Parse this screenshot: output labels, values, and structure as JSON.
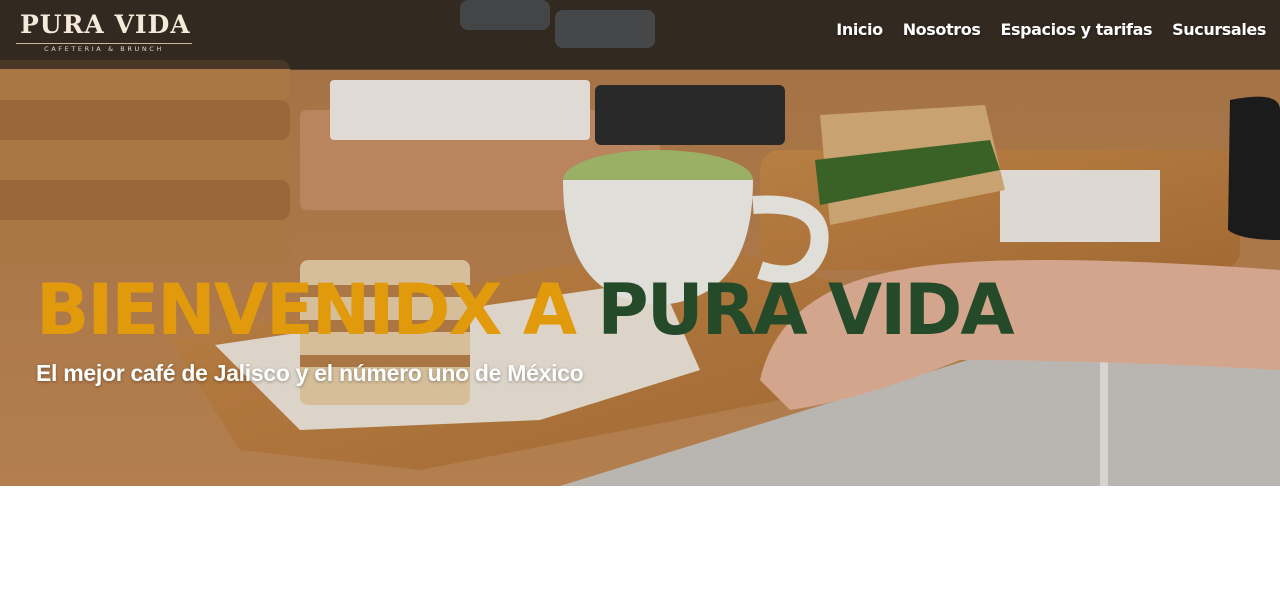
{
  "header": {
    "logo": {
      "name": "PURA VIDA",
      "tagline": "CAFETERIA & BRUNCH"
    },
    "nav": [
      {
        "label": "Inicio"
      },
      {
        "label": "Nosotros"
      },
      {
        "label": "Espacios y tarifas"
      },
      {
        "label": "Sucursales"
      }
    ]
  },
  "hero": {
    "headline_part1": "BIENVENIDX A",
    "headline_part2": "PURA VIDA",
    "subtitle": "El mejor café de Jalisco y el número uno de México",
    "colors": {
      "headline_accent": "#e19a0c",
      "headline_brand": "#254a2a"
    },
    "image": "hero-cafe-photo"
  }
}
